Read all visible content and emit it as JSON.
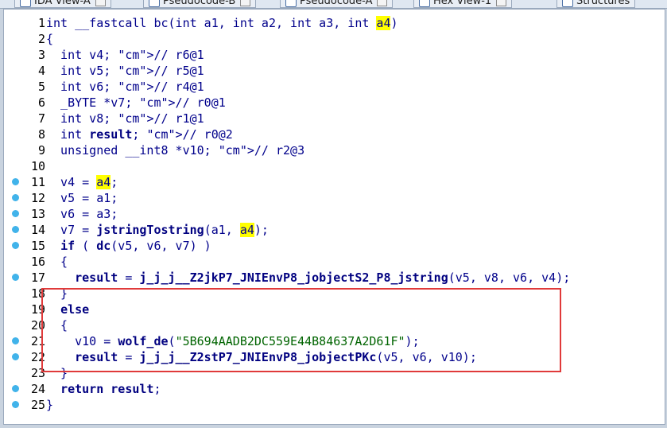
{
  "tabs": [
    "IDA View-A",
    "Pseudocode-B",
    "Pseudocode-A",
    "Hex View-1",
    "Structures"
  ],
  "code_lines": [
    {
      "n": "1",
      "dot": false,
      "text": "int __fastcall bc(int a1, int a2, int a3, int a4)"
    },
    {
      "n": "2",
      "dot": false,
      "text": "{"
    },
    {
      "n": "3",
      "dot": false,
      "text": "  int v4; // r6@1"
    },
    {
      "n": "4",
      "dot": false,
      "text": "  int v5; // r5@1"
    },
    {
      "n": "5",
      "dot": false,
      "text": "  int v6; // r4@1"
    },
    {
      "n": "6",
      "dot": false,
      "text": "  _BYTE *v7; // r0@1"
    },
    {
      "n": "7",
      "dot": false,
      "text": "  int v8; // r1@1"
    },
    {
      "n": "8",
      "dot": false,
      "text": "  int result; // r0@2"
    },
    {
      "n": "9",
      "dot": false,
      "text": "  unsigned __int8 *v10; // r2@3"
    },
    {
      "n": "10",
      "dot": false,
      "text": ""
    },
    {
      "n": "11",
      "dot": true,
      "text": "  v4 = a4;"
    },
    {
      "n": "12",
      "dot": true,
      "text": "  v5 = a1;"
    },
    {
      "n": "13",
      "dot": true,
      "text": "  v6 = a3;"
    },
    {
      "n": "14",
      "dot": true,
      "text": "  v7 = jstringTostring(a1, a4);"
    },
    {
      "n": "15",
      "dot": true,
      "text": "  if ( dc(v5, v6, v7) )"
    },
    {
      "n": "16",
      "dot": false,
      "text": "  {"
    },
    {
      "n": "17",
      "dot": true,
      "text": "    result = j_j_j__Z2jkP7_JNIEnvP8_jobjectS2_P8_jstring(v5, v8, v6, v4);"
    },
    {
      "n": "18",
      "dot": false,
      "text": "  }"
    },
    {
      "n": "19",
      "dot": false,
      "text": "  else"
    },
    {
      "n": "20",
      "dot": false,
      "text": "  {"
    },
    {
      "n": "21",
      "dot": true,
      "text": "    v10 = wolf_de(\"5B694AADB2DC559E44B84637A2D61F\");"
    },
    {
      "n": "22",
      "dot": true,
      "text": "    result = j_j_j__Z2stP7_JNIEnvP8_jobjectPKc(v5, v6, v10);"
    },
    {
      "n": "23",
      "dot": false,
      "text": "  }"
    },
    {
      "n": "24",
      "dot": true,
      "text": "  return result;"
    },
    {
      "n": "25",
      "dot": true,
      "text": "}"
    }
  ],
  "colors": {
    "highlight": "#ffff00",
    "breakpoint_dot": "#41b3ea",
    "box": "#e03a3a"
  }
}
